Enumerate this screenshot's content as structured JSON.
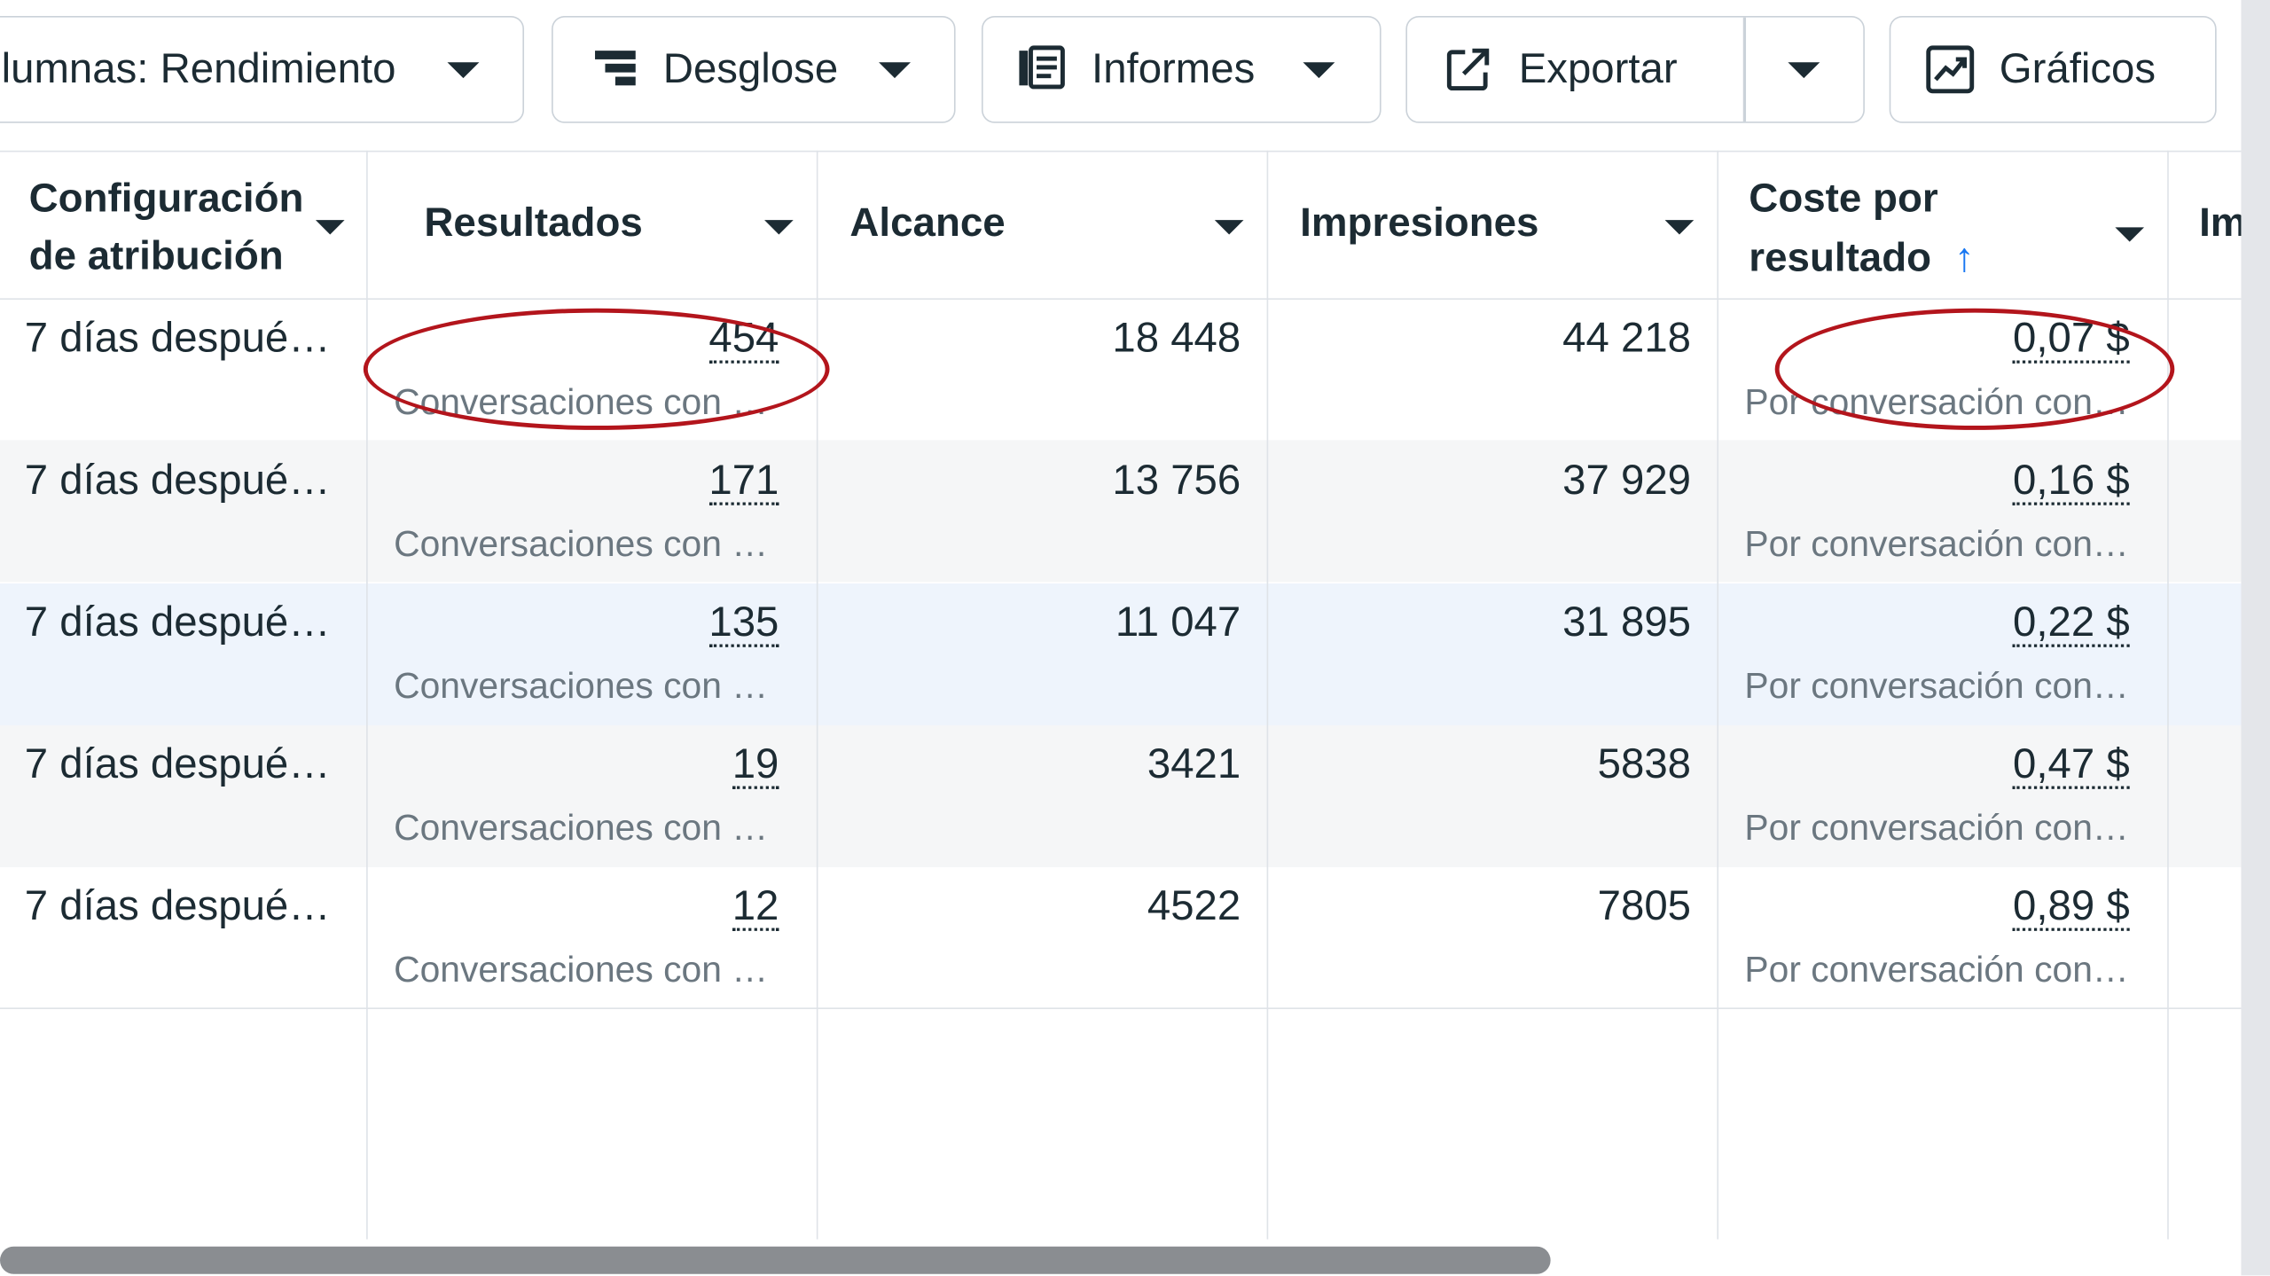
{
  "toolbar": {
    "columns_label": "lumnas: Rendimiento",
    "breakdown_label": "Desglose",
    "reports_label": "Informes",
    "export_label": "Exportar",
    "charts_label": "Gráficos"
  },
  "table": {
    "headers": {
      "attribution_line1": "Configuración",
      "attribution_line2": "de atribución",
      "results": "Resultados",
      "reach": "Alcance",
      "impressions": "Impresiones",
      "cost_line1": "Coste por",
      "cost_line2": "resultado",
      "cost_sort_arrow": "↑",
      "partial_next": "Im"
    },
    "rows": [
      {
        "attribution": "7 días despué…",
        "results": "454",
        "results_sub": "Conversaciones con …",
        "reach": "18 448",
        "impressions": "44 218",
        "cost": "0,07 $",
        "cost_sub": "Por conversación con…"
      },
      {
        "attribution": "7 días despué…",
        "results": "171",
        "results_sub": "Conversaciones con …",
        "reach": "13 756",
        "impressions": "37 929",
        "cost": "0,16 $",
        "cost_sub": "Por conversación con…"
      },
      {
        "attribution": "7 días despué…",
        "results": "135",
        "results_sub": "Conversaciones con …",
        "reach": "11 047",
        "impressions": "31 895",
        "cost": "0,22 $",
        "cost_sub": "Por conversación con…"
      },
      {
        "attribution": "7 días despué…",
        "results": "19",
        "results_sub": "Conversaciones con …",
        "reach": "3421",
        "impressions": "5838",
        "cost": "0,47 $",
        "cost_sub": "Por conversación con…"
      },
      {
        "attribution": "7 días despué…",
        "results": "12",
        "results_sub": "Conversaciones con …",
        "reach": "4522",
        "impressions": "7805",
        "cost": "0,89 $",
        "cost_sub": "Por conversación con…"
      }
    ]
  },
  "colors": {
    "annotation_circle": "#b3151c",
    "sort_arrow": "#1877f2",
    "highlight_row": "#eef4fc",
    "alt_row": "#f5f6f7"
  },
  "scrollbar": {
    "horizontal_position_fraction": 0.0
  }
}
